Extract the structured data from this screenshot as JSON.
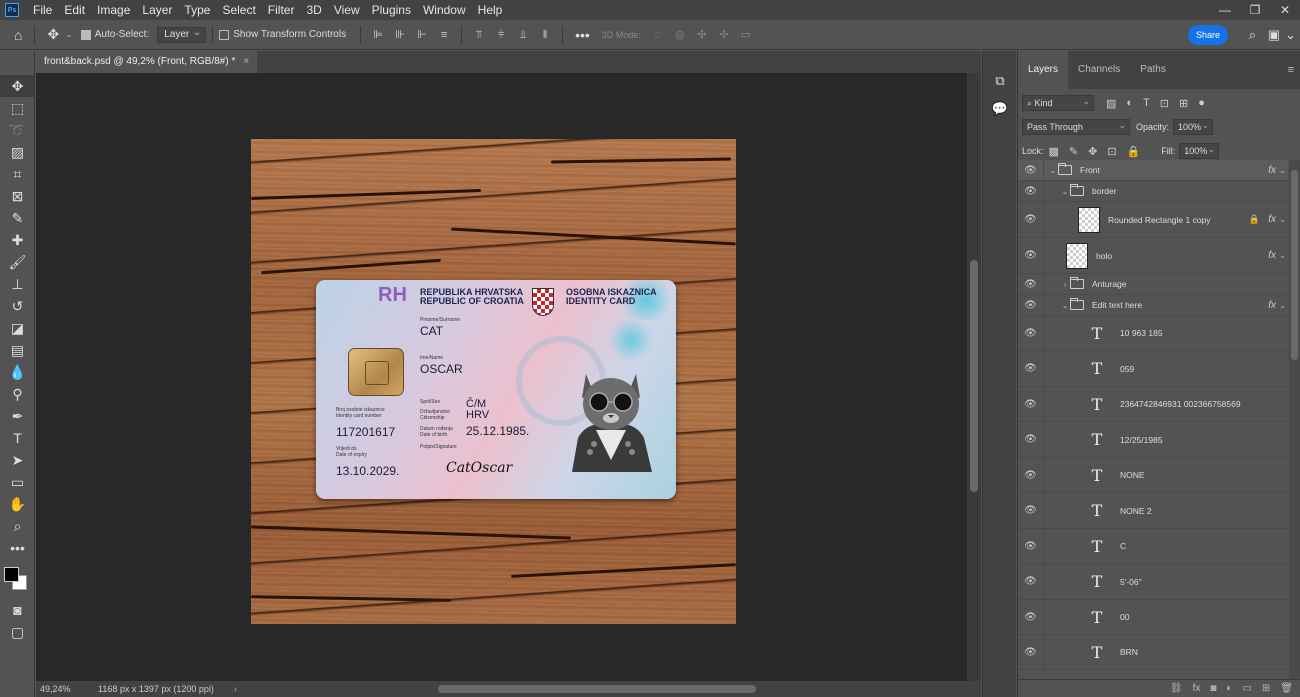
{
  "app": {
    "logo": "Ps"
  },
  "menu": [
    "File",
    "Edit",
    "Image",
    "Layer",
    "Type",
    "Select",
    "Filter",
    "3D",
    "View",
    "Plugins",
    "Window",
    "Help"
  ],
  "window_controls": {
    "minimize": "—",
    "restore": "❐",
    "close": "✕"
  },
  "options": {
    "auto_select_label": "Auto-Select:",
    "auto_select_value": "Layer",
    "show_transform_label": "Show Transform Controls",
    "mode3d_label": "3D Mode:",
    "share_label": "Share"
  },
  "document": {
    "tab_title": "front&back.psd @ 49,2% (Front, RGB/8#) *",
    "tab_close": "×",
    "zoom": "49,24%",
    "dimensions": "1168 px x 1397 px (1200 ppi)"
  },
  "card": {
    "rh": "RH",
    "country_line1": "REPUBLIKA HRVATSKA",
    "country_line2": "REPUBLIC OF CROATIA",
    "doc_line1": "OSOBNA ISKAZNICA",
    "doc_line2": "IDENTITY CARD",
    "surname_label": "Prezime/Surname",
    "surname": "CAT",
    "name_label": "Ime/Name",
    "name": "OSCAR",
    "sex_label": "Spol/Sex",
    "sex": "Č/M",
    "citizenship_label": "Državljanstvo\nCitizenship",
    "citizenship": "HRV",
    "dob_label": "Datum rođenja\nDate of birth",
    "dob": "25.12.1985.",
    "idnum_label": "Broj osobne iskaznice\nIdentity card number",
    "idnum": "117201617",
    "signature_label": "Potpis/Signature",
    "signature": "CatOscar",
    "expiry_label": "Vrijedi do\nDate of expiry",
    "expiry": "13.10.2029."
  },
  "panel": {
    "tabs": [
      "Layers",
      "Channels",
      "Paths"
    ],
    "kind": "Kind",
    "blend_mode": "Pass Through",
    "opacity_label": "Opacity:",
    "opacity": "100%",
    "lock_label": "Lock:",
    "fill_label": "Fill:",
    "fill": "100%"
  },
  "layers": [
    {
      "name": "Front",
      "type": "group",
      "indent": 0,
      "open": true,
      "fx": true,
      "selected": true
    },
    {
      "name": "border",
      "type": "group",
      "indent": 1,
      "open": true,
      "fx": false
    },
    {
      "name": "Rounded Rectangle 1 copy",
      "type": "shape",
      "indent": 2,
      "fx": true,
      "locked": true
    },
    {
      "name": "holo",
      "type": "pixel",
      "indent": 1,
      "fx": true
    },
    {
      "name": "Anturage",
      "type": "group",
      "indent": 1,
      "open": false,
      "fx": false
    },
    {
      "name": "Edit text here",
      "type": "group",
      "indent": 1,
      "open": true,
      "fx": true
    },
    {
      "name": "10 963 185",
      "type": "text",
      "indent": 2
    },
    {
      "name": "059",
      "type": "text",
      "indent": 2
    },
    {
      "name": "2364742846931 002366758569",
      "type": "text",
      "indent": 2
    },
    {
      "name": "12/25/1985",
      "type": "text",
      "indent": 2
    },
    {
      "name": "NONE",
      "type": "text",
      "indent": 2
    },
    {
      "name": "NONE 2",
      "type": "text",
      "indent": 2
    },
    {
      "name": "C",
      "type": "text",
      "indent": 2
    },
    {
      "name": "5'-06\"",
      "type": "text",
      "indent": 2
    },
    {
      "name": "00",
      "type": "text",
      "indent": 2
    },
    {
      "name": "BRN",
      "type": "text",
      "indent": 2
    }
  ],
  "colors": {
    "accent": "#1473e6",
    "foreground": "#000000",
    "background": "#ffffff"
  }
}
